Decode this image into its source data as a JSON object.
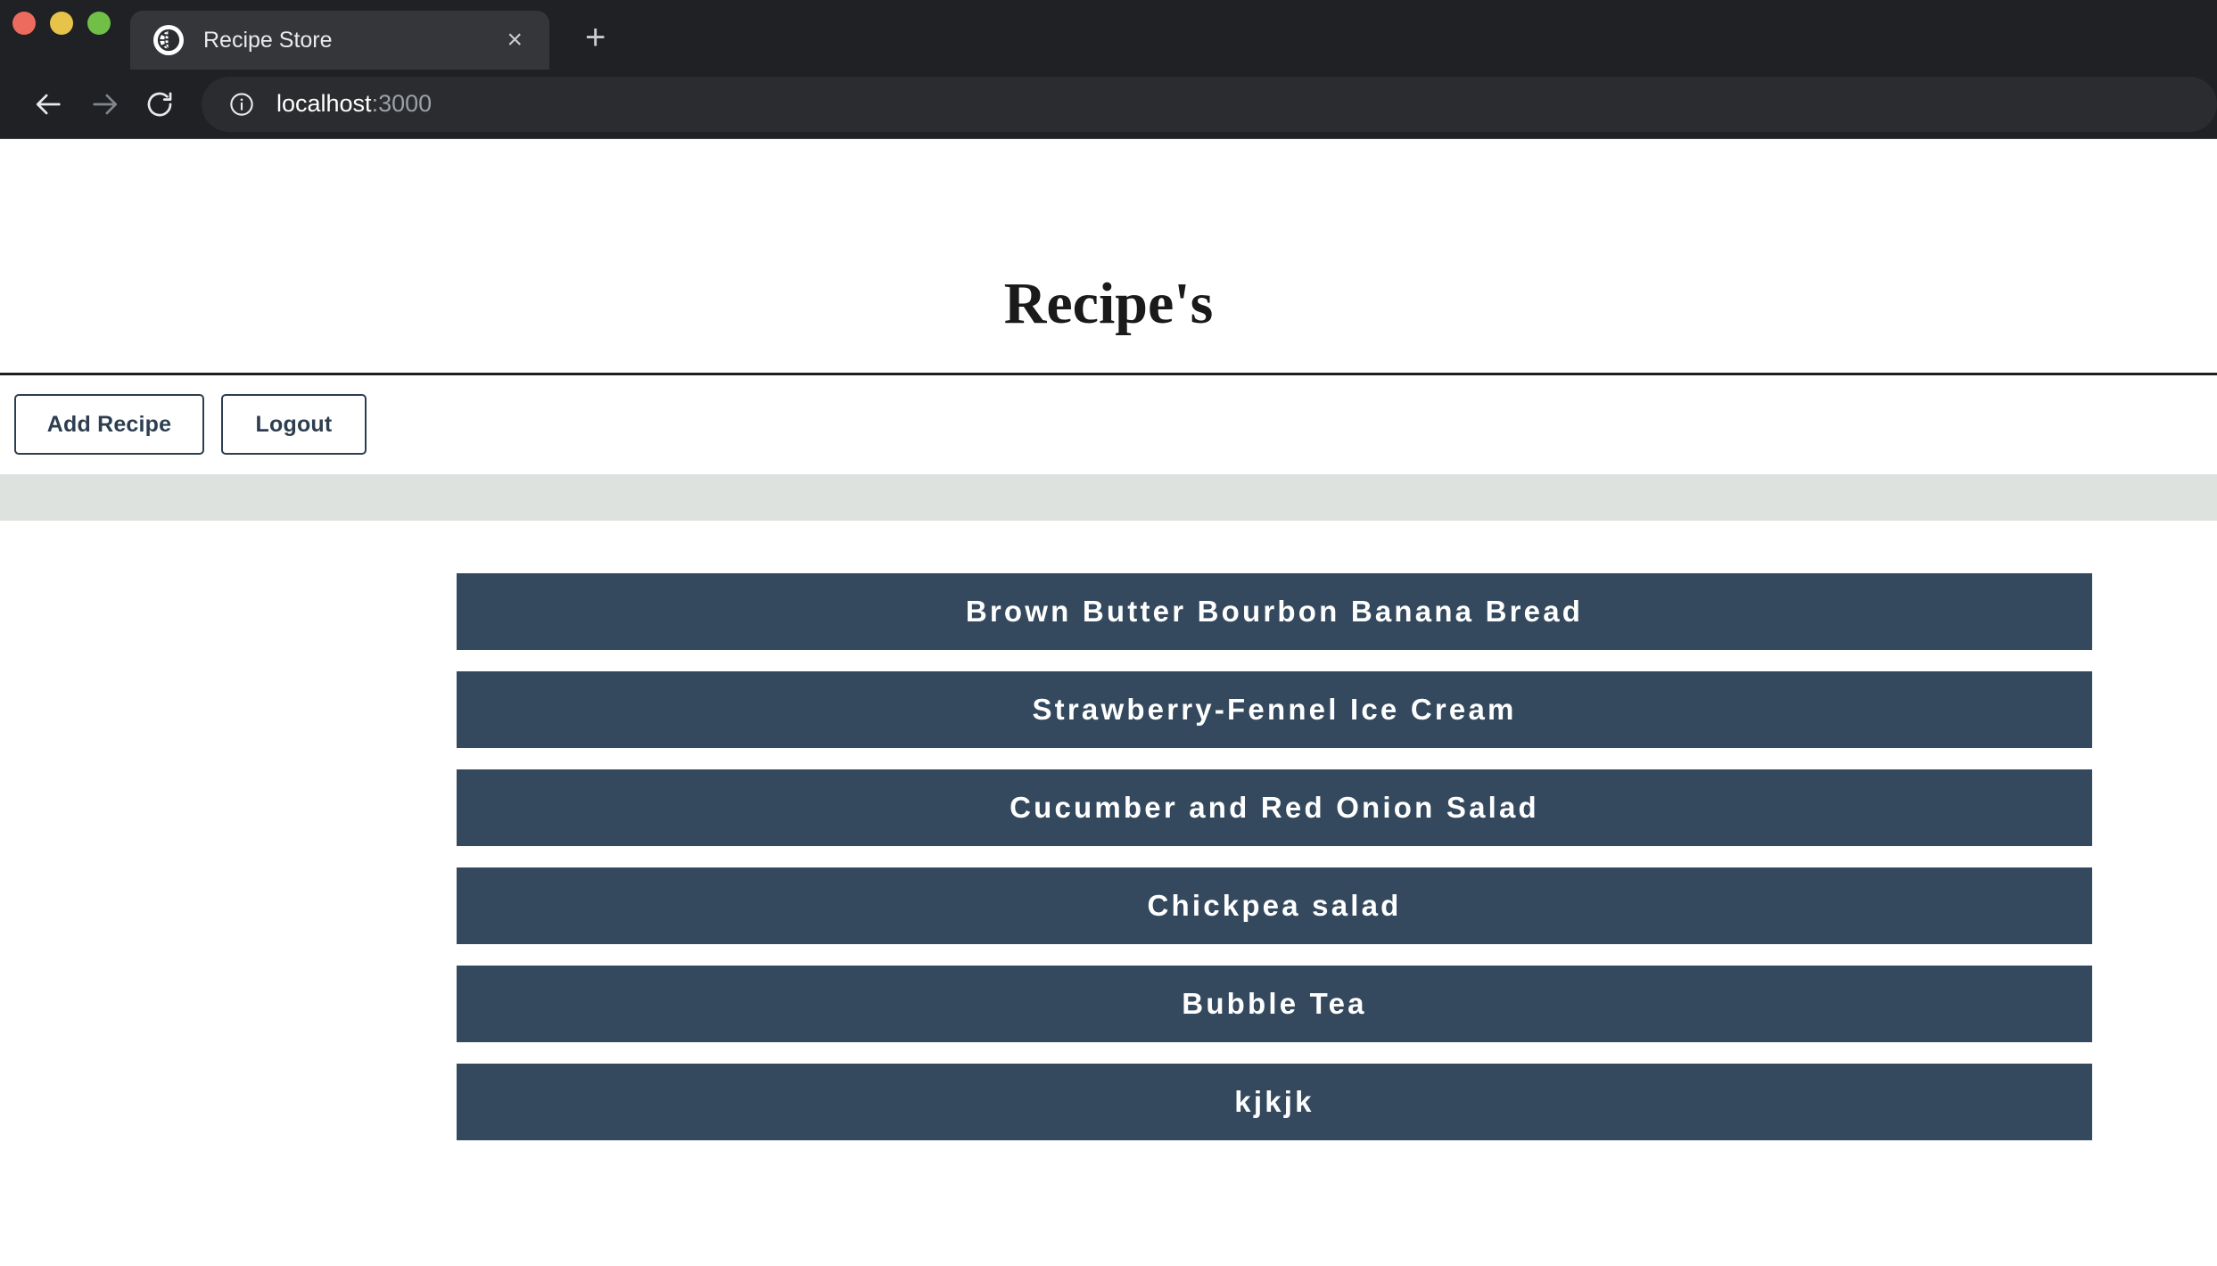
{
  "browser": {
    "window_controls": {
      "close_color": "#ed6a5e",
      "minimize_color": "#e8c34a",
      "maximize_color": "#70c048"
    },
    "tab": {
      "title": "Recipe Store",
      "favicon": "globe-icon",
      "close_label": "×"
    },
    "new_tab_label": "+",
    "nav": {
      "back": "back-arrow-icon",
      "forward": "forward-arrow-icon",
      "reload": "reload-icon"
    },
    "omnibox": {
      "security_icon": "info-icon",
      "host": "localhost",
      "port": ":3000",
      "full_url": "localhost:3000"
    }
  },
  "page": {
    "title": "Recipe's",
    "toolbar": {
      "add_recipe_label": "Add Recipe",
      "logout_label": "Logout"
    },
    "colors": {
      "item_background": "#34495e",
      "item_text": "#ffffff",
      "accent_border": "#2c3e50",
      "sage_bar": "#dde2de"
    },
    "recipes": [
      {
        "name": "Brown Butter Bourbon Banana Bread"
      },
      {
        "name": "Strawberry-Fennel Ice Cream"
      },
      {
        "name": "Cucumber and Red Onion Salad"
      },
      {
        "name": "Chickpea salad"
      },
      {
        "name": "Bubble Tea"
      },
      {
        "name": "kjkjk"
      }
    ]
  }
}
